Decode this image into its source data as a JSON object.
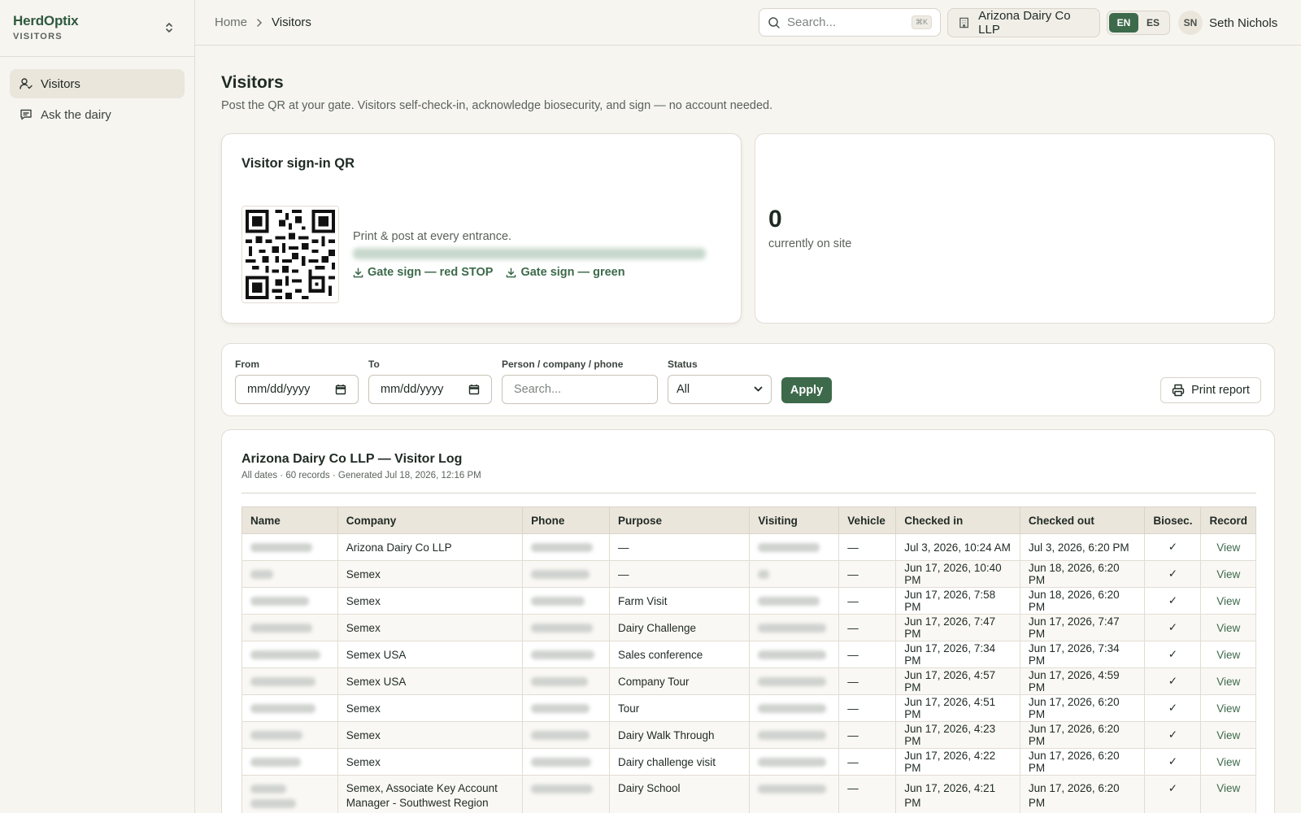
{
  "sidebar": {
    "brand": "HerdOptix",
    "brand_sub": "VISITORS",
    "items": [
      {
        "label": "Visitors",
        "icon": "user-check-icon",
        "active": true
      },
      {
        "label": "Ask the dairy",
        "icon": "message-square-icon",
        "active": false
      }
    ]
  },
  "header": {
    "breadcrumb": [
      "Home",
      "Visitors"
    ],
    "search_placeholder": "Search...",
    "search_shortcut": "⌘K",
    "org_name": "Arizona Dairy Co LLP",
    "langs": [
      "EN",
      "ES"
    ],
    "active_lang": "EN",
    "user_initials": "SN",
    "user_name": "Seth Nichols"
  },
  "page": {
    "title": "Visitors",
    "subtitle": "Post the QR at your gate. Visitors self-check-in, acknowledge biosecurity, and sign — no account needed."
  },
  "qr": {
    "title": "Visitor sign-in QR",
    "text": "Print & post at every entrance.",
    "link_red": "Gate sign — red STOP",
    "link_green": "Gate sign — green"
  },
  "on_site": {
    "count": "0",
    "label": "currently on site"
  },
  "filters": {
    "from_label": "From",
    "from_placeholder": "mm/dd/yyyy",
    "to_label": "To",
    "to_placeholder": "mm/dd/yyyy",
    "search_label": "Person / company / phone",
    "search_placeholder": "Search...",
    "status_label": "Status",
    "status_value": "All",
    "apply_label": "Apply",
    "print_label": "Print report"
  },
  "log": {
    "title": "Arizona Dairy Co LLP — Visitor Log",
    "meta": "All dates · 60 records · Generated Jul 18, 2026, 12:16 PM",
    "columns": [
      "Name",
      "Company",
      "Phone",
      "Purpose",
      "Visiting",
      "Vehicle",
      "Checked in",
      "Checked out",
      "Biosec.",
      "Record"
    ],
    "rows": [
      {
        "company": "Arizona Dairy Co LLP",
        "purpose": "—",
        "vehicle": "—",
        "checked_in": "Jul 3, 2026, 10:24 AM",
        "checked_out": "Jul 3, 2026, 6:20 PM",
        "biosec": "✓",
        "record": "View"
      },
      {
        "company": "Semex",
        "purpose": "—",
        "vehicle": "—",
        "checked_in": "Jun 17, 2026, 10:40 PM",
        "checked_out": "Jun 18, 2026, 6:20 PM",
        "biosec": "✓",
        "record": "View"
      },
      {
        "company": "Semex",
        "purpose": "Farm Visit",
        "vehicle": "—",
        "checked_in": "Jun 17, 2026, 7:58 PM",
        "checked_out": "Jun 18, 2026, 6:20 PM",
        "biosec": "✓",
        "record": "View"
      },
      {
        "company": "Semex",
        "purpose": "Dairy Challenge",
        "vehicle": "—",
        "checked_in": "Jun 17, 2026, 7:47 PM",
        "checked_out": "Jun 17, 2026, 7:47 PM",
        "biosec": "✓",
        "record": "View"
      },
      {
        "company": "Semex USA",
        "purpose": "Sales conference",
        "vehicle": "—",
        "checked_in": "Jun 17, 2026, 7:34 PM",
        "checked_out": "Jun 17, 2026, 7:34 PM",
        "biosec": "✓",
        "record": "View"
      },
      {
        "company": "Semex USA",
        "purpose": "Company Tour",
        "vehicle": "—",
        "checked_in": "Jun 17, 2026, 4:57 PM",
        "checked_out": "Jun 17, 2026, 4:59 PM",
        "biosec": "✓",
        "record": "View"
      },
      {
        "company": "Semex",
        "purpose": "Tour",
        "vehicle": "—",
        "checked_in": "Jun 17, 2026, 4:51 PM",
        "checked_out": "Jun 17, 2026, 6:20 PM",
        "biosec": "✓",
        "record": "View"
      },
      {
        "company": "Semex",
        "purpose": "Dairy Walk Through",
        "vehicle": "—",
        "checked_in": "Jun 17, 2026, 4:23 PM",
        "checked_out": "Jun 17, 2026, 6:20 PM",
        "biosec": "✓",
        "record": "View"
      },
      {
        "company": "Semex",
        "purpose": "Dairy challenge visit",
        "vehicle": "—",
        "checked_in": "Jun 17, 2026, 4:22 PM",
        "checked_out": "Jun 17, 2026, 6:20 PM",
        "biosec": "✓",
        "record": "View"
      },
      {
        "company": "Semex, Associate Key Account Manager - Southwest Region",
        "purpose": "Dairy School",
        "vehicle": "—",
        "checked_in": "Jun 17, 2026, 4:21 PM",
        "checked_out": "Jun 17, 2026, 6:20 PM",
        "biosec": "✓",
        "record": "View"
      }
    ]
  }
}
